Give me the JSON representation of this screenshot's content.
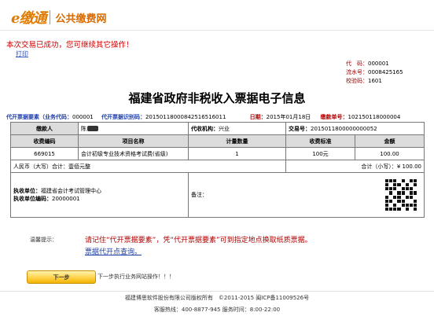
{
  "header": {
    "brand": "e缴通",
    "site_name": "公共缴费网",
    "success_message": "本次交易已成功，您可继续其它操作！",
    "print_link": "打印"
  },
  "codes": {
    "code_label": "代　码：",
    "code_value": "000001",
    "serial_label": "流水号：",
    "serial_value": "0008425165",
    "check_label": "校验码：",
    "check_value": "1601"
  },
  "title": "福建省政府非税收入票据电子信息",
  "meta": {
    "agency_label": "代开票据要素",
    "agency_code_label": "（业务代码：",
    "agency_code_value": "000001",
    "receipt_id_label": "代开票据识别码：",
    "receipt_id_value": "20150118000842516516011",
    "date_label": "日期：",
    "date_value": "2015年01月18日",
    "pay_no_label": "缴款单号：",
    "pay_no_value": "102150118000004"
  },
  "table": {
    "payer_label": "缴款人",
    "payer_value": "陈",
    "collector_label": "代收机构：",
    "collector_value": "兴业",
    "txn_label": "交易号：",
    "txn_value": "2015011800000000052",
    "col_code": "收费编码",
    "col_item": "项目名称",
    "col_unit": "计量数量",
    "col_std": "收费标准",
    "col_amount": "金额",
    "row_code": "669015",
    "row_item": "会计初级专业技术资格考试费(省级)",
    "row_unit": "1",
    "row_std": "100元",
    "row_amount": "100.00",
    "rmb_big_label": "人民币（大写）合计：",
    "rmb_big_value": "壹佰元整",
    "rmb_small_label": "合计（小写）：",
    "rmb_small_value": "¥ 100.00",
    "exec_unit_label": "执收单位：",
    "exec_unit_value": "福建省会计考试管理中心",
    "exec_code_label": "执收单位编码：",
    "exec_code_value": "20000001",
    "remark_label": "备注："
  },
  "tips": {
    "label": "温馨提示：",
    "text": "请记住“代开票据要素”，凭“代开票据要素”可到指定地点换取纸质票据。",
    "link": "票据代开点查询。"
  },
  "next": {
    "button": "下一步",
    "text": "下一步执行业务网站操作！！！"
  },
  "footer": {
    "copyright": "福建博思软件股份有限公司版权所有　©2011-2015 闽ICP备11009526号",
    "hotline": "客服热线：400-8877-945 服务时间：8:00-22:00"
  },
  "colors": {
    "brand_orange": "#e07a00",
    "alert_red": "#d40000",
    "link_blue": "#1f3fa8"
  }
}
